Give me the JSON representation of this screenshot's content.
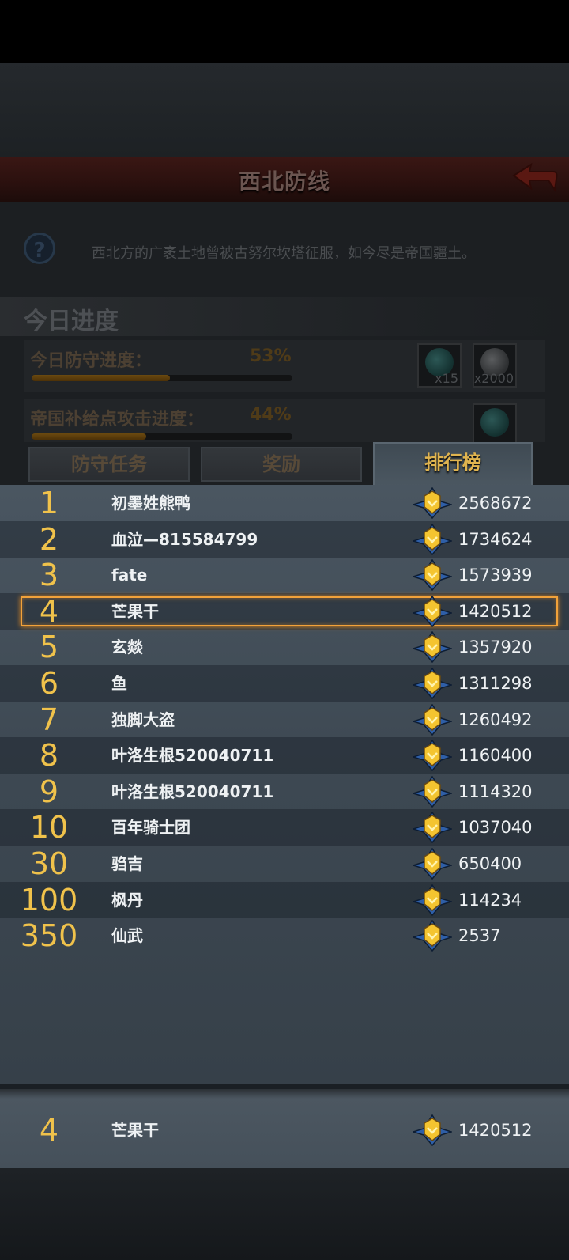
{
  "header": {
    "title": "西北防线"
  },
  "description": "西北方的广袤土地曾被古努尔坎塔征服，如今尽是帝国疆土。",
  "help_glyph": "?",
  "progress": {
    "title": "今日进度",
    "rows": [
      {
        "label": "今日防守进度：",
        "percent_text": "53%",
        "fill": 0.53,
        "rewards": [
          {
            "icon": "gem-icon",
            "qty": "x15"
          },
          {
            "icon": "coin-icon",
            "qty": "x2000"
          }
        ]
      },
      {
        "label": "帝国补给点攻击进度：",
        "percent_text": "44%",
        "fill": 0.44,
        "rewards": [
          {
            "icon": "gem-icon",
            "qty": ""
          }
        ]
      }
    ]
  },
  "tabs": [
    {
      "label": "防守任务",
      "active": false
    },
    {
      "label": "奖励",
      "active": false
    },
    {
      "label": "排行榜",
      "active": true
    }
  ],
  "leaderboard": [
    {
      "rank": "1",
      "name": "初墨姓熊鸭",
      "score": "2568672"
    },
    {
      "rank": "2",
      "name": "血泣—815584799",
      "score": "1734624"
    },
    {
      "rank": "3",
      "name": "fate",
      "score": "1573939"
    },
    {
      "rank": "4",
      "name": "芒果干",
      "score": "1420512",
      "highlight": true
    },
    {
      "rank": "5",
      "name": "玄燚",
      "score": "1357920"
    },
    {
      "rank": "6",
      "name": "鱼",
      "score": "1311298"
    },
    {
      "rank": "7",
      "name": "独脚大盗",
      "score": "1260492"
    },
    {
      "rank": "8",
      "name": "叶洛生根520040711",
      "score": "1160400"
    },
    {
      "rank": "9",
      "name": "叶洛生根520040711",
      "score": "1114320"
    },
    {
      "rank": "10",
      "name": "百年骑士团",
      "score": "1037040"
    },
    {
      "rank": "30",
      "name": "驺吉",
      "score": "650400"
    },
    {
      "rank": "100",
      "name": "枫丹",
      "score": "114234"
    },
    {
      "rank": "350",
      "name": "仙武",
      "score": "2537"
    }
  ],
  "self": {
    "rank": "4",
    "name": "芒果干",
    "score": "1420512"
  },
  "colors": {
    "rank": "#f0c24b",
    "highlight_border": "#f2a23a",
    "active_tab_text": "#e0b44f",
    "badge_gold": "#f4c430",
    "badge_blue": "#2f5fa8"
  }
}
